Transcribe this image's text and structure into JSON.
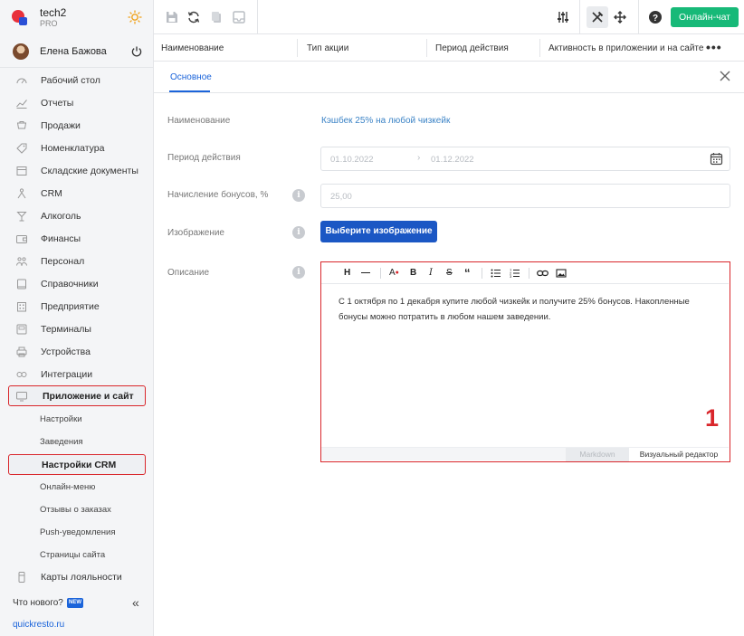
{
  "brand": {
    "name": "tech2",
    "plan": "PRO"
  },
  "user": {
    "name": "Елена Бажова"
  },
  "nav": [
    {
      "label": "Рабочий стол",
      "icon": "dashboard-icon"
    },
    {
      "label": "Отчеты",
      "icon": "chart-icon"
    },
    {
      "label": "Продажи",
      "icon": "cart-icon"
    },
    {
      "label": "Номенклатура",
      "icon": "tag-icon"
    },
    {
      "label": "Складские документы",
      "icon": "warehouse-icon"
    },
    {
      "label": "CRM",
      "icon": "people-icon"
    },
    {
      "label": "Алкоголь",
      "icon": "glass-icon"
    },
    {
      "label": "Финансы",
      "icon": "wallet-icon"
    },
    {
      "label": "Персонал",
      "icon": "staff-icon"
    },
    {
      "label": "Справочники",
      "icon": "book-icon"
    },
    {
      "label": "Предприятие",
      "icon": "building-icon"
    },
    {
      "label": "Терминалы",
      "icon": "terminal-icon"
    },
    {
      "label": "Устройства",
      "icon": "printer-icon"
    },
    {
      "label": "Интеграции",
      "icon": "link-icon"
    }
  ],
  "nav_active": {
    "label": "Приложение и сайт",
    "icon": "monitor-icon"
  },
  "subnav": {
    "settings": "Настройки",
    "venues": "Заведения",
    "crm_settings": "Настройки CRM",
    "online_menu": "Онлайн-меню",
    "reviews": "Отзывы о заказах",
    "push": "Push-уведомления",
    "pages": "Страницы сайта"
  },
  "nav_loyalty": {
    "label": "Карты лояльности",
    "icon": "card-icon"
  },
  "footer": {
    "whats_new": "Что нового?",
    "badge": "NEW",
    "site": "quickresto.ru"
  },
  "toolbar": {
    "chat_label": "Онлайн-чат"
  },
  "table_header": {
    "col1": "Наименование",
    "col2": "Тип акции",
    "col3": "Период действия",
    "col4": "Активность в приложении и на сайте"
  },
  "tabs": {
    "main": "Основное"
  },
  "form": {
    "name_label": "Наименование",
    "name_value": "Кэшбек 25% на любой чизкейк",
    "period_label": "Период действия",
    "period_start": "01.10.2022",
    "period_end": "01.12.2022",
    "bonus_label": "Начисление бонусов, %",
    "bonus_value": "25,00",
    "image_label": "Изображение",
    "image_button": "Выберите изображение",
    "description_label": "Описание"
  },
  "editor": {
    "text": "С 1 октября по 1 декабря купите любой чизкейк и получите 25% бонусов. Накопленные бонусы можно потратить в любом нашем заведении.",
    "annotation": "1",
    "tab_markdown": "Markdown",
    "tab_visual": "Визуальный редактор"
  },
  "colors": {
    "accent": "#1b64da",
    "green": "#17b978",
    "highlight": "#d9262b"
  }
}
